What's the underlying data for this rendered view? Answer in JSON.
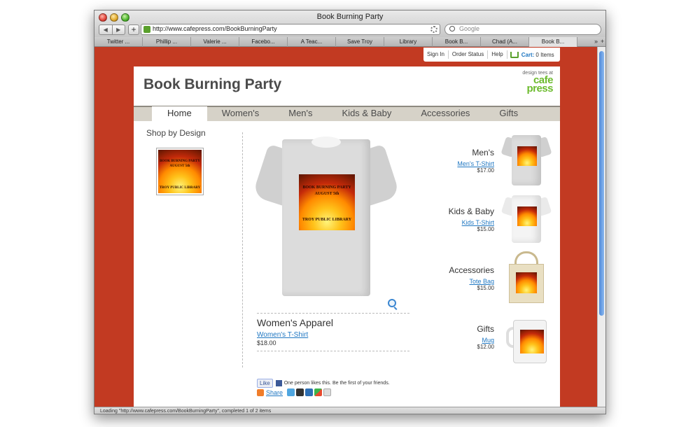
{
  "browser": {
    "window_title": "Book Burning Party",
    "url": "http://www.cafepress.com/BookBurningParty",
    "search_placeholder": "Google",
    "nav_back": "◀",
    "nav_forward": "▶",
    "add_bookmark": "+",
    "tabs": [
      "Twitter ...",
      "Phillip ...",
      "Valerie ...",
      "Facebo...",
      "A Teac...",
      "Save Troy",
      "Library",
      "Book B...",
      "Chad (A...",
      "Book B..."
    ],
    "status": "Loading \"http://www.cafepress.com/BookBurningParty\", completed 1 of 2 items"
  },
  "topbar": {
    "sign_in": "Sign In",
    "order_status": "Order Status",
    "help": "Help",
    "cart_label": "Cart:",
    "cart_count": "0 Items"
  },
  "header": {
    "title": "Book Burning Party",
    "brand_tagline": "design tees at",
    "brand_line1": "cafe",
    "brand_line2": "press"
  },
  "nav": [
    "Home",
    "Women's",
    "Men's",
    "Kids & Baby",
    "Accessories",
    "Gifts"
  ],
  "sidebar": {
    "heading": "Shop by Design"
  },
  "design_print": {
    "line1": "BOOK BURNING PARTY",
    "line2": "AUGUST 5th",
    "line3": "TROY PUBLIC LIBRARY"
  },
  "main": {
    "category": "Women's Apparel",
    "product": "Women's T-Shirt",
    "price": "$18.00"
  },
  "categories": [
    {
      "title": "Men's",
      "product": "Men's T-Shirt",
      "price": "$17.00"
    },
    {
      "title": "Kids & Baby",
      "product": "Kids T-Shirt",
      "price": "$15.00"
    },
    {
      "title": "Accessories",
      "product": "Tote Bag",
      "price": "$15.00"
    },
    {
      "title": "Gifts",
      "product": "Mug",
      "price": "$12.00"
    }
  ],
  "social": {
    "like": "Like",
    "like_text": "One person likes this. Be the first of your friends.",
    "share": "Share"
  },
  "colors": {
    "background": "#c23a22",
    "brand_green": "#6cbb2d",
    "link_blue": "#1f77c2"
  }
}
